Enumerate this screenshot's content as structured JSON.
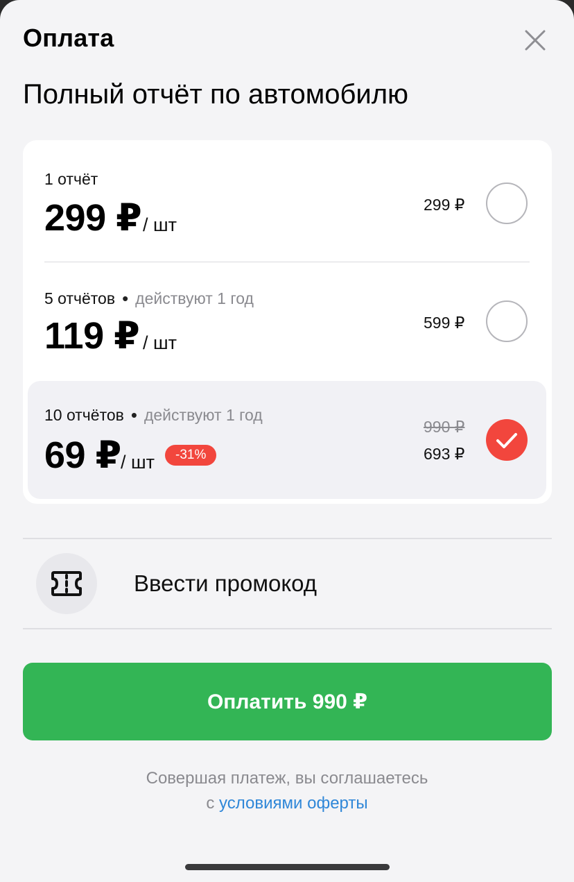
{
  "header": {
    "title": "Оплата"
  },
  "subtitle": "Полный отчёт по автомобилю",
  "options": [
    {
      "label": "1 отчёт",
      "validity": "",
      "price": "299 ₽",
      "unit": "/ шт",
      "old_total": "",
      "total": "299 ₽",
      "discount": "",
      "selected": false
    },
    {
      "label": "5 отчётов",
      "validity": "действуют 1 год",
      "price": "119 ₽",
      "unit": "/ шт",
      "old_total": "",
      "total": "599 ₽",
      "discount": "",
      "selected": false
    },
    {
      "label": "10 отчётов",
      "validity": "действуют 1 год",
      "price": "69 ₽",
      "unit": "/ шт",
      "old_total": "990 ₽",
      "total": "693 ₽",
      "discount": "-31%",
      "selected": true
    }
  ],
  "promo": {
    "label": "Ввести промокод",
    "icon": "ticket-icon"
  },
  "pay_button": {
    "label": "Оплатить 990 ₽"
  },
  "legal": {
    "line1": "Совершая платеж, вы соглашаетесь",
    "prefix": "с ",
    "link": "условиями оферты"
  },
  "colors": {
    "accent_green": "#33b555",
    "accent_red": "#f2463d",
    "link_blue": "#2f87d8"
  }
}
